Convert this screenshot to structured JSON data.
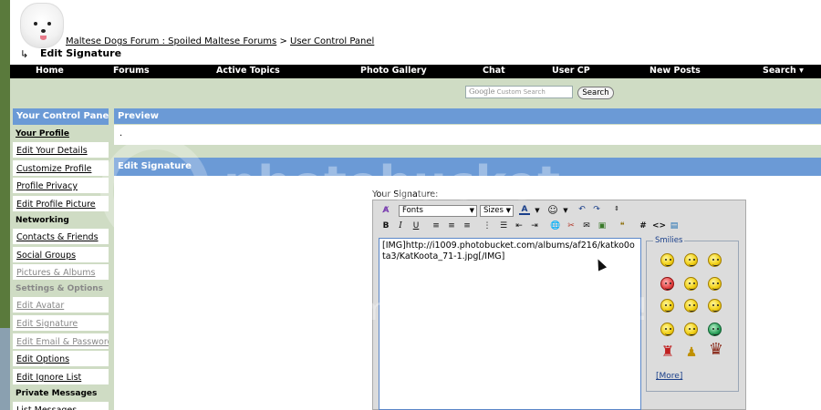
{
  "header": {
    "breadcrumb_forum": "Maltese Dogs Forum : Spoiled Maltese Forums",
    "breadcrumb_sep": ">",
    "breadcrumb_ucp": "User Control Panel",
    "page_title": "Edit Signature"
  },
  "nav": {
    "items": [
      "Home",
      "Forums",
      "Active Topics",
      "Photo Gallery",
      "Chat",
      "User CP",
      "New Posts",
      "Search ▾"
    ]
  },
  "search": {
    "google_label": "Google",
    "placeholder": "Custom Search",
    "button_label": "Search"
  },
  "sidebar": {
    "header": "Your Control Panel",
    "sections": {
      "profile": "Your Profile",
      "networking": "Networking",
      "settings": "Settings & Options",
      "pm": "Private Messages"
    },
    "profile_items": [
      "Edit Your Details",
      "Customize Profile",
      "Profile Privacy",
      "Edit Profile Picture"
    ],
    "networking_items": [
      "Contacts & Friends",
      "Social Groups",
      "Pictures & Albums"
    ],
    "settings_items": [
      "Edit Avatar",
      "Edit Signature",
      "Edit Email & Password",
      "Edit Options",
      "Edit Ignore List"
    ],
    "pm_items": [
      "List Messages"
    ]
  },
  "main": {
    "preview_title": "Preview",
    "preview_content": ".",
    "edit_title": "Edit Signature",
    "signature_label": "Your Signature:",
    "signature_value": "[IMG]http://i1009.photobucket.com/albums/af216/katko0ota3/KatKoota_71-1.jpg[/IMG]"
  },
  "editor": {
    "fonts_label": "Fonts",
    "sizes_label": "Sizes",
    "toolbar_row2": [
      "B",
      "I",
      "U"
    ],
    "smilies_legend": "Smilies",
    "more_label": "[More]"
  },
  "watermark": {
    "line1": "photobucket",
    "line2": "Protect your memories for less!"
  },
  "colors": {
    "nav_bg": "#000000",
    "panel_header": "#6b9ad6",
    "panel_bg": "#cfdcc4",
    "textarea_border": "#5a86c8"
  }
}
